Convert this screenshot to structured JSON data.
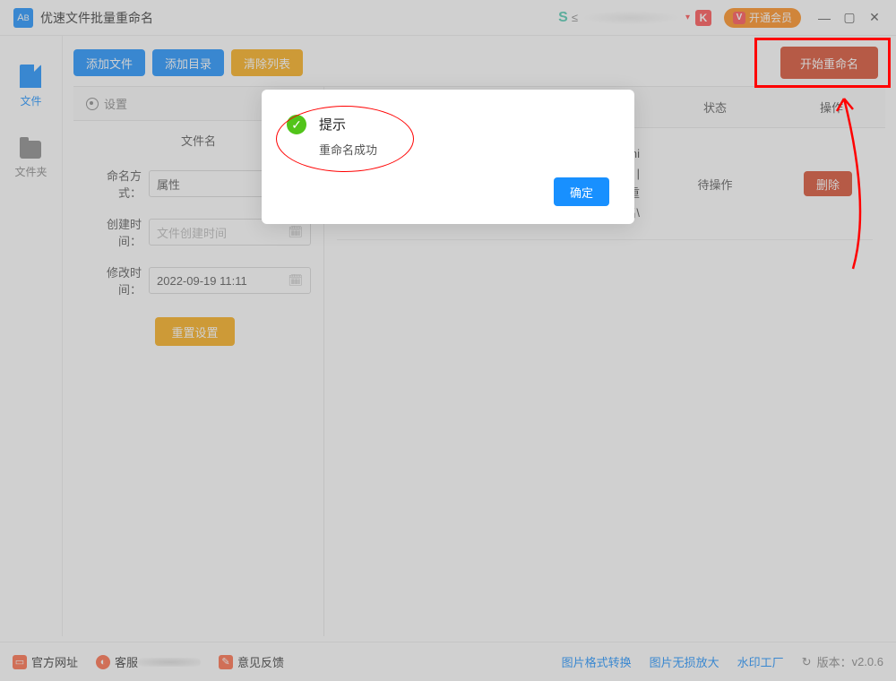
{
  "header": {
    "app_title": "优速文件批量重命名",
    "vip_label": "开通会员"
  },
  "sidebar": {
    "items": [
      {
        "label": "文件"
      },
      {
        "label": "文件夹"
      }
    ]
  },
  "toolbar": {
    "add_file": "添加文件",
    "add_dir": "添加目录",
    "clear_list": "清除列表",
    "start": "开始重命名"
  },
  "settings": {
    "head": "设置",
    "col_title": "文件名",
    "method_label": "命名方式：",
    "method_value": "属性",
    "create_label": "创建时间：",
    "create_placeholder": "文件创建时间",
    "modify_label": "修改时间：",
    "modify_value": "2022-09-19 11:11",
    "reset": "重置设置"
  },
  "table": {
    "headers": {
      "status": "状态",
      "op": "操作"
    },
    "row": {
      "name_line1": "mi",
      "name_line2": "|",
      "name_line3": "重",
      "name_line4": "命名\\",
      "status": "待操作",
      "delete": "删除"
    }
  },
  "footer": {
    "official": "官方网址",
    "service": "客服",
    "feedback": "意见反馈",
    "links": [
      "图片格式转换",
      "图片无损放大",
      "水印工厂"
    ],
    "version_label": "版本：",
    "version": "v2.0.6"
  },
  "modal": {
    "title": "提示",
    "message": "重命名成功",
    "ok": "确定"
  }
}
